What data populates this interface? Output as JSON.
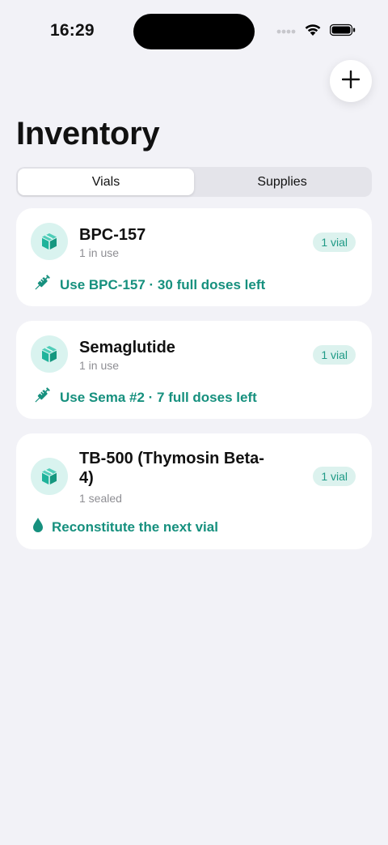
{
  "status_bar": {
    "time": "16:29"
  },
  "page": {
    "title": "Inventory"
  },
  "tabs": [
    {
      "label": "Vials",
      "active": true
    },
    {
      "label": "Supplies",
      "active": false
    }
  ],
  "items": [
    {
      "name": "BPC-157",
      "status": "1 in use",
      "badge": "1 vial",
      "action_icon": "syringe-icon",
      "action": "Use BPC-157 · 30 full doses left"
    },
    {
      "name": "Semaglutide",
      "status": "1 in use",
      "badge": "1 vial",
      "action_icon": "syringe-icon",
      "action": "Use Sema #2 · 7 full doses left"
    },
    {
      "name": "TB-500 (Thymosin Beta-4)",
      "status": "1 sealed",
      "badge": "1 vial",
      "action_icon": "drop-icon",
      "action": "Reconstitute the next vial"
    }
  ],
  "colors": {
    "accent": "#16907e",
    "badge_bg": "#dcf2ee",
    "icon_bg": "#d9f3ef",
    "background": "#f2f2f7"
  }
}
